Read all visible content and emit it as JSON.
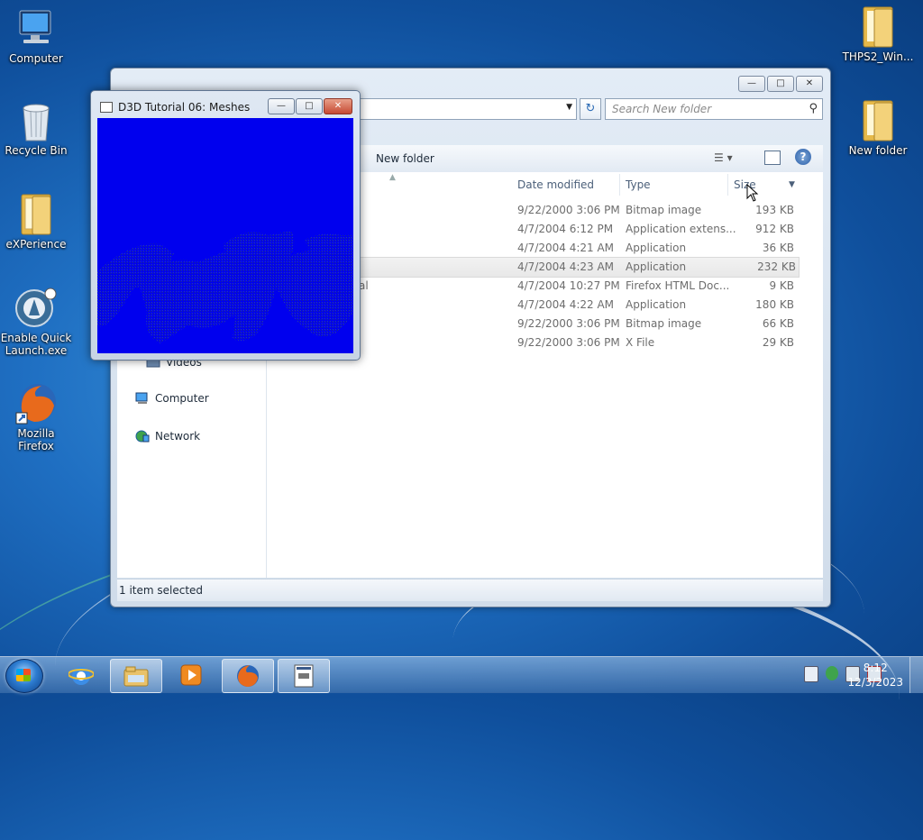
{
  "desktop": {
    "icons": [
      {
        "label": "Computer"
      },
      {
        "label": "Recycle Bin"
      },
      {
        "label": "eXPerience"
      },
      {
        "label": "Enable Quick Launch.exe"
      },
      {
        "label": "Mozilla Firefox"
      },
      {
        "label": "THPS2_Win..."
      },
      {
        "label": "New folder"
      }
    ]
  },
  "explorer": {
    "search_placeholder": "Search New folder",
    "toolbar": {
      "new_folder": "New folder"
    },
    "nav": {
      "videos": "Videos",
      "computer": "Computer",
      "network": "Network"
    },
    "columns": {
      "date": "Date modified",
      "type": "Type",
      "size": "Size"
    },
    "rows": [
      {
        "name": "",
        "date": "9/22/2000 3:06 PM",
        "type": "Bitmap image",
        "size": "193 KB"
      },
      {
        "name": "",
        "date": "4/7/2004 6:12 PM",
        "type": "Application extens...",
        "size": "912 KB"
      },
      {
        "name": "",
        "date": "4/7/2004 4:21 AM",
        "type": "Application",
        "size": "36 KB"
      },
      {
        "name": "",
        "date": "4/7/2004 4:23 AM",
        "type": "Application",
        "size": "232 KB"
      },
      {
        "name": "al",
        "date": "4/7/2004 10:27 PM",
        "type": "Firefox HTML Doc...",
        "size": "9 KB"
      },
      {
        "name": "",
        "date": "4/7/2004 4:22 AM",
        "type": "Application",
        "size": "180 KB"
      },
      {
        "name": "",
        "date": "9/22/2000 3:06 PM",
        "type": "Bitmap image",
        "size": "66 KB"
      },
      {
        "name": "",
        "date": "9/22/2000 3:06 PM",
        "type": "X File",
        "size": "29 KB"
      }
    ],
    "status": "1 item selected"
  },
  "d3d_window": {
    "title": "D3D Tutorial 06: Meshes"
  },
  "taskbar": {
    "time": "8:12",
    "date": "12/3/2023"
  },
  "colors": {
    "d3d_bg": "#0000ee",
    "taskbar": "#3c6ea8"
  }
}
